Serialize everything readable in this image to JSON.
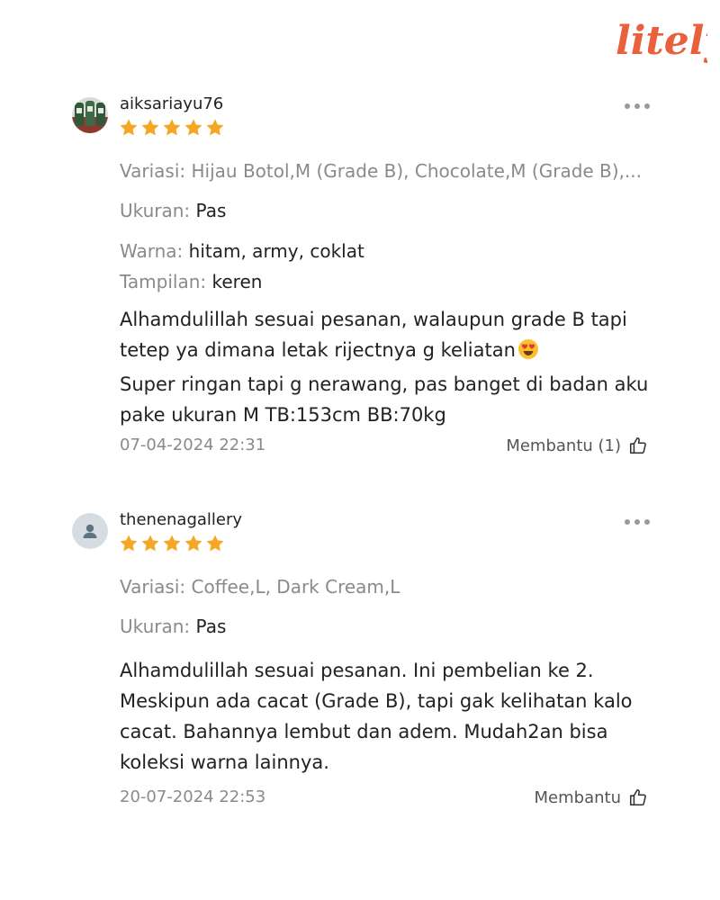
{
  "brand": {
    "logo_text": "litely",
    "logo_color": "#E8603C"
  },
  "colors": {
    "star": "#F5A623",
    "label_gray": "#8a8a8a",
    "text": "#222222"
  },
  "reviews": [
    {
      "username": "aiksariayu76",
      "avatar": "product-photo-avatar",
      "rating": 5,
      "variasi_label": "Variasi:",
      "variasi_value": "Hijau Botol,M (Grade B), Chocolate,M (Grade B),...",
      "ukuran_label": "Ukuran:",
      "ukuran_value": "Pas",
      "warna_label": "Warna:",
      "warna_value": "hitam, army, coklat",
      "tampilan_label": "Tampilan:",
      "tampilan_value": "keren",
      "comment_lines": [
        "Alhamdulillah sesuai pesanan, walaupun grade B tapi",
        "tetep ya dimana letak rijectnya g keliatan",
        "Super ringan tapi g nerawang, pas banget di badan aku",
        "pake ukuran M TB:153cm BB:70kg"
      ],
      "emoji": "heart-eyes-emoji",
      "date": "07-04-2024 22:31",
      "helpful_label": "Membantu (1)"
    },
    {
      "username": "thenenagallery",
      "avatar": "default-user-avatar",
      "rating": 5,
      "variasi_label": "Variasi:",
      "variasi_value": "Coffee,L, Dark Cream,L",
      "ukuran_label": "Ukuran:",
      "ukuran_value": "Pas",
      "comment_lines": [
        "Alhamdulillah sesuai pesanan. Ini pembelian ke 2.",
        "Meskipun ada cacat (Grade B), tapi gak kelihatan kalo",
        "cacat. Bahannya lembut dan adem. Mudah2an bisa",
        "koleksi warna lainnya."
      ],
      "date": "20-07-2024 22:53",
      "helpful_label": "Membantu"
    }
  ]
}
